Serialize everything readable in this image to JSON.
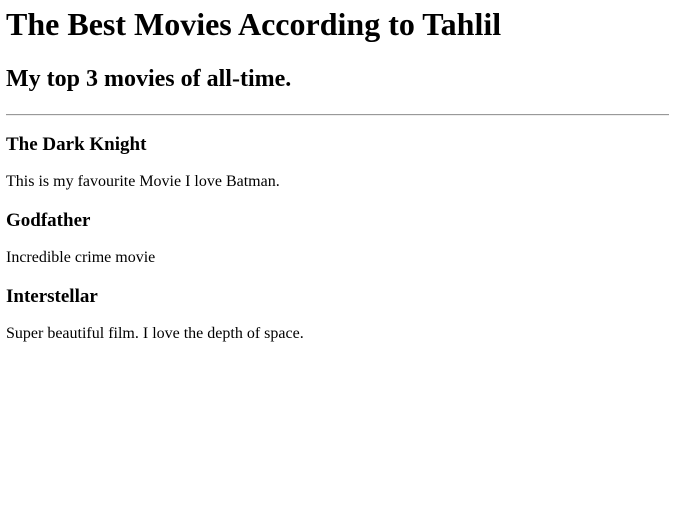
{
  "page": {
    "title": "The Best Movies According to Tahlil",
    "subtitle": "My top 3 movies of all-time."
  },
  "movies": [
    {
      "title": "The Dark Knight",
      "description": "This is my favourite Movie I love Batman."
    },
    {
      "title": "Godfather",
      "description": "Incredible crime movie"
    },
    {
      "title": "Interstellar",
      "description": "Super beautiful film. I love the depth of space."
    }
  ]
}
